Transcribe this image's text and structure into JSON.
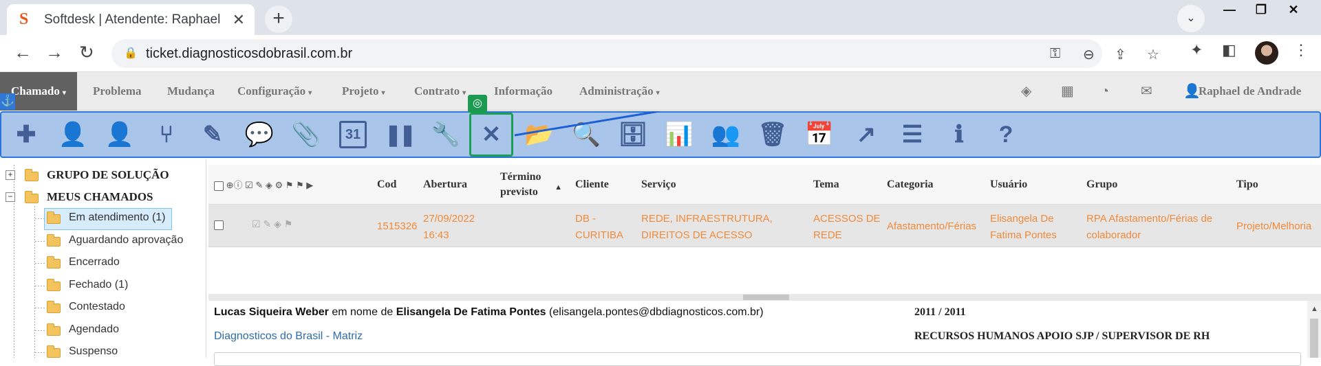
{
  "browser": {
    "tab_title": "Softdesk | Atendente: Raphael de Andrade",
    "favicon_letter": "S",
    "tab_close": "✕",
    "new_tab": "+",
    "url": "ticket.diagnosticosdobrasil.com.br",
    "window_controls": {
      "minimize": "—",
      "maximize": "❐",
      "close": "✕"
    }
  },
  "app_nav": {
    "items": [
      {
        "label": "Chamado",
        "has_caret": true,
        "active": true
      },
      {
        "label": "Problema",
        "has_caret": false
      },
      {
        "label": "Mudança",
        "has_caret": false
      },
      {
        "label": "Configuração",
        "has_caret": true
      },
      {
        "label": "Projeto",
        "has_caret": true
      },
      {
        "label": "Contrato",
        "has_caret": true
      },
      {
        "label": "Informação",
        "has_caret": false
      },
      {
        "label": "Administração",
        "has_caret": true
      }
    ],
    "caret": "▾",
    "user_name": "Raphael de Andrade"
  },
  "toolbar": {
    "buttons": [
      {
        "icon": "plus-icon",
        "glyph": "✚"
      },
      {
        "icon": "user-forward-icon",
        "glyph": "👤"
      },
      {
        "icon": "add-user-icon",
        "glyph": "👤"
      },
      {
        "icon": "branch-icon",
        "glyph": "⑂"
      },
      {
        "icon": "pencil-icon",
        "glyph": "✎"
      },
      {
        "icon": "comment-icon",
        "glyph": "💬"
      },
      {
        "icon": "paperclip-icon",
        "glyph": "📎"
      },
      {
        "icon": "calendar-31-icon",
        "glyph": "31"
      },
      {
        "icon": "pause-icon",
        "glyph": "❚❚"
      },
      {
        "icon": "wrench-icon",
        "glyph": "🔧"
      },
      {
        "icon": "wrench-screwdriver-icon",
        "glyph": "✕"
      },
      {
        "icon": "folder-open-icon",
        "glyph": "📂"
      },
      {
        "icon": "search-icon",
        "glyph": "🔍"
      },
      {
        "icon": "archive-icon",
        "glyph": "🗄"
      },
      {
        "icon": "bar-chart-icon",
        "glyph": "📊"
      },
      {
        "icon": "users-icon",
        "glyph": "👥"
      },
      {
        "icon": "trash-icon",
        "glyph": "🗑"
      },
      {
        "icon": "calendar-icon",
        "glyph": "📅"
      },
      {
        "icon": "share-icon",
        "glyph": "↗"
      },
      {
        "icon": "list-icon",
        "glyph": "☰"
      },
      {
        "icon": "info-icon",
        "glyph": "ℹ"
      },
      {
        "icon": "help-icon",
        "glyph": "?"
      }
    ],
    "selected_index": 10
  },
  "sidebar": {
    "groups": [
      {
        "label": "GRUPO DE SOLUÇÃO",
        "expanded": false
      },
      {
        "label": "MEUS CHAMADOS",
        "expanded": true
      }
    ],
    "items": [
      {
        "label": "Em atendimento (1)",
        "selected": true
      },
      {
        "label": "Aguardando aprovação"
      },
      {
        "label": "Encerrado"
      },
      {
        "label": "Fechado (1)"
      },
      {
        "label": "Contestado"
      },
      {
        "label": "Agendado"
      },
      {
        "label": "Suspenso"
      }
    ]
  },
  "grid": {
    "columns": [
      "Cod",
      "Abertura",
      "Término previsto",
      "Cliente",
      "Serviço",
      "Tema",
      "Categoria",
      "Usuário",
      "Grupo",
      "Tipo"
    ],
    "sort_indicator": "▲",
    "header_icons": "⊕ⓘ ☑ ✎ ◈ ⚙ ⚑ ⚑ ▶",
    "row": {
      "cod": "1515326",
      "abertura": "27/09/2022 16:43",
      "termino": "",
      "cliente": "DB - CURITIBA",
      "servico": "REDE, INFRAESTRUTURA, DIREITOS DE ACESSO",
      "tema": "ACESSOS DE REDE",
      "categoria": "Afastamento/Férias",
      "usuario": "Elisangela De Fatima Pontes",
      "grupo": "RPA Afastamento/Férias de colaborador",
      "tipo": "Projeto/Melhoria",
      "icons": "☑ ✎ ◈   ⚑"
    }
  },
  "detail": {
    "requester": "Lucas Siqueira Weber",
    "on_behalf_text": "em nome de",
    "user": "Elisangela De Fatima Pontes",
    "email": "(elisangela.pontes@dbdiagnosticos.com.br)",
    "company": "Diagnosticos do Brasil - Matriz",
    "extension": "2011 / 2011",
    "department": "RECURSOS HUMANOS APOIO SJP / SUPERVISOR DE RH"
  },
  "colors": {
    "toolbar_bg": "#a9c6ea",
    "toolbar_border": "#2c74d9",
    "icon_color": "#415e95",
    "row_text": "#f18a3a",
    "selection_green": "#1b9f55"
  }
}
